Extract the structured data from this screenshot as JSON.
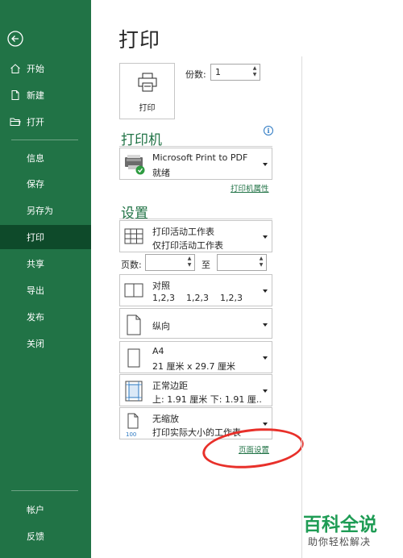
{
  "sidebar": {
    "items": [
      {
        "label": "开始",
        "icon": "home-icon"
      },
      {
        "label": "新建",
        "icon": "new-doc-icon"
      },
      {
        "label": "打开",
        "icon": "folder-icon"
      },
      {
        "label": "信息"
      },
      {
        "label": "保存"
      },
      {
        "label": "另存为"
      },
      {
        "label": "打印"
      },
      {
        "label": "共享"
      },
      {
        "label": "导出"
      },
      {
        "label": "发布"
      },
      {
        "label": "关闭"
      }
    ],
    "bottom": [
      {
        "label": "帐户"
      },
      {
        "label": "反馈"
      }
    ],
    "active": "打印",
    "bg_color": "#217346",
    "active_color": "#0e4a2a"
  },
  "main": {
    "title": "打印",
    "print_button_label": "打印",
    "copies_label": "份数:",
    "copies_value": "1",
    "printer_section_title": "打印机",
    "printer": {
      "name": "Microsoft Print to PDF",
      "status": "就绪"
    },
    "printer_properties_link": "打印机属性",
    "settings_section_title": "设置",
    "scope": {
      "line1": "打印活动工作表",
      "line2": "仅打印活动工作表"
    },
    "pages_label": "页数:",
    "pages_to_label": "至",
    "collate": {
      "line1": "对照",
      "line2": "1,2,3    1,2,3    1,2,3"
    },
    "orientation": "纵向",
    "paper": {
      "line1": "A4",
      "line2": "21 厘米 x 29.7 厘米"
    },
    "margins": {
      "line1": "正常边距",
      "line2": "上: 1.91 厘米 下: 1.91 厘..."
    },
    "scaling": {
      "line1": "无缩放",
      "line2": "打印实际大小的工作表",
      "icon_text": "100"
    },
    "page_setup_link": "页面设置",
    "accent_color": "#217346"
  },
  "watermark": {
    "line1": "百科全说",
    "line2": "助你轻松解决"
  }
}
